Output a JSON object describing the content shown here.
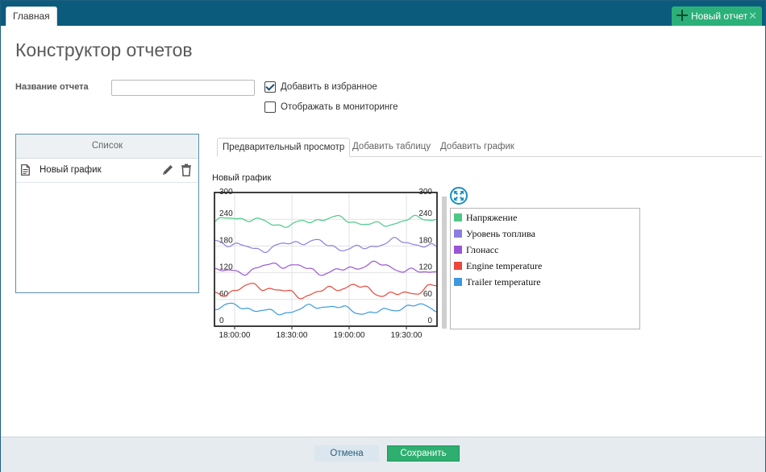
{
  "topbar": {
    "home_tab": "Главная",
    "new_report_tab": "Новый отчет",
    "close_glyph": "✕",
    "accent": "#0b5b7c",
    "new_tab_color": "#2bb07a"
  },
  "page": {
    "title": "Конструктор отчетов"
  },
  "form": {
    "name_label": "Название отчета",
    "name_value": "",
    "favorite_label": "Добавить в избранное",
    "favorite_checked": true,
    "monitoring_label": "Отображать в мониторинге",
    "monitoring_checked": false
  },
  "list": {
    "header": "Список",
    "items": [
      {
        "label": "Новый график",
        "icon": "document-icon"
      }
    ]
  },
  "tabs": [
    {
      "label": "Предварительный просмотр",
      "active": true
    },
    {
      "label": "Добавить таблицу",
      "active": false
    },
    {
      "label": "Добавить график",
      "active": false
    }
  ],
  "chart_data": {
    "type": "line",
    "title": "Новый график",
    "x_ticks": [
      "18:00:00",
      "18:30:00",
      "19:00:00",
      "19:30:00"
    ],
    "y_ticks": [
      "0",
      "60",
      "120",
      "180",
      "240",
      "300"
    ],
    "ylim": [
      0,
      300
    ],
    "grid": true,
    "legend_position": "right",
    "series": [
      {
        "name": "Напряжение",
        "color": "#4cc987",
        "base": 235,
        "amp": 14
      },
      {
        "name": "Уровень топлива",
        "color": "#8a7fe0",
        "base": 182,
        "amp": 16
      },
      {
        "name": "Глонасс",
        "color": "#9a55d6",
        "base": 130,
        "amp": 16
      },
      {
        "name": "Engine temperature",
        "color": "#e9483a",
        "base": 80,
        "amp": 18
      },
      {
        "name": "Trailer temperature",
        "color": "#3b99e0",
        "base": 38,
        "amp": 14
      }
    ]
  },
  "footer": {
    "cancel_label": "Отмена",
    "save_label": "Сохранить"
  }
}
